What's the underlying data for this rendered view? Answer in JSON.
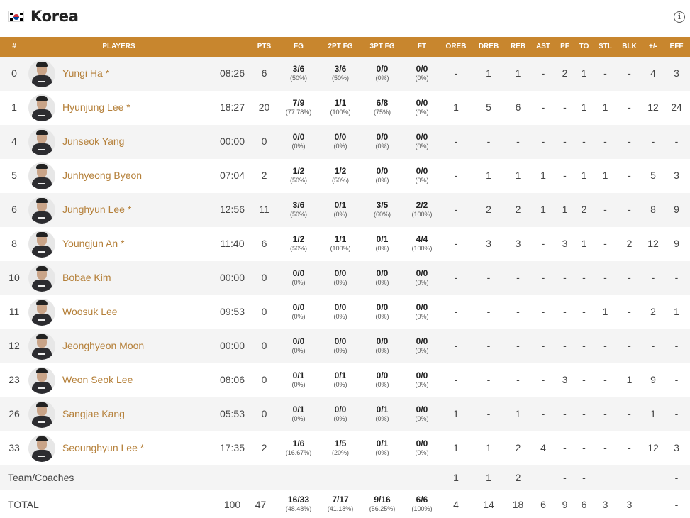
{
  "team": {
    "name": "Korea",
    "flag_icon": "korea-flag-icon",
    "info_icon": "info-icon"
  },
  "columns": [
    "#",
    "PLAYERS",
    "PTS",
    "FG",
    "2PT FG",
    "3PT FG",
    "FT",
    "OREB",
    "DREB",
    "REB",
    "AST",
    "PF",
    "TO",
    "STL",
    "BLK",
    "+/-",
    "EFF"
  ],
  "players": [
    {
      "no": "0",
      "name": "Yungi Ha *",
      "min": "08:26",
      "pts": "6",
      "fg": "3/6",
      "fgp": "(50%)",
      "fg2": "3/6",
      "fg2p": "(50%)",
      "fg3": "0/0",
      "fg3p": "(0%)",
      "ft": "0/0",
      "ftp": "(0%)",
      "oreb": "-",
      "dreb": "1",
      "reb": "1",
      "ast": "-",
      "pf": "2",
      "to": "1",
      "stl": "-",
      "blk": "-",
      "pm": "4",
      "eff": "3"
    },
    {
      "no": "1",
      "name": "Hyunjung Lee *",
      "min": "18:27",
      "pts": "20",
      "fg": "7/9",
      "fgp": "(77.78%)",
      "fg2": "1/1",
      "fg2p": "(100%)",
      "fg3": "6/8",
      "fg3p": "(75%)",
      "ft": "0/0",
      "ftp": "(0%)",
      "oreb": "1",
      "dreb": "5",
      "reb": "6",
      "ast": "-",
      "pf": "-",
      "to": "1",
      "stl": "1",
      "blk": "-",
      "pm": "12",
      "eff": "24"
    },
    {
      "no": "4",
      "name": "Junseok Yang",
      "min": "00:00",
      "pts": "0",
      "fg": "0/0",
      "fgp": "(0%)",
      "fg2": "0/0",
      "fg2p": "(0%)",
      "fg3": "0/0",
      "fg3p": "(0%)",
      "ft": "0/0",
      "ftp": "(0%)",
      "oreb": "-",
      "dreb": "-",
      "reb": "-",
      "ast": "-",
      "pf": "-",
      "to": "-",
      "stl": "-",
      "blk": "-",
      "pm": "-",
      "eff": "-"
    },
    {
      "no": "5",
      "name": "Junhyeong Byeon",
      "min": "07:04",
      "pts": "2",
      "fg": "1/2",
      "fgp": "(50%)",
      "fg2": "1/2",
      "fg2p": "(50%)",
      "fg3": "0/0",
      "fg3p": "(0%)",
      "ft": "0/0",
      "ftp": "(0%)",
      "oreb": "-",
      "dreb": "1",
      "reb": "1",
      "ast": "1",
      "pf": "-",
      "to": "1",
      "stl": "1",
      "blk": "-",
      "pm": "5",
      "eff": "3"
    },
    {
      "no": "6",
      "name": "Junghyun Lee *",
      "min": "12:56",
      "pts": "11",
      "fg": "3/6",
      "fgp": "(50%)",
      "fg2": "0/1",
      "fg2p": "(0%)",
      "fg3": "3/5",
      "fg3p": "(60%)",
      "ft": "2/2",
      "ftp": "(100%)",
      "oreb": "-",
      "dreb": "2",
      "reb": "2",
      "ast": "1",
      "pf": "1",
      "to": "2",
      "stl": "-",
      "blk": "-",
      "pm": "8",
      "eff": "9"
    },
    {
      "no": "8",
      "name": "Youngjun An *",
      "min": "11:40",
      "pts": "6",
      "fg": "1/2",
      "fgp": "(50%)",
      "fg2": "1/1",
      "fg2p": "(100%)",
      "fg3": "0/1",
      "fg3p": "(0%)",
      "ft": "4/4",
      "ftp": "(100%)",
      "oreb": "-",
      "dreb": "3",
      "reb": "3",
      "ast": "-",
      "pf": "3",
      "to": "1",
      "stl": "-",
      "blk": "2",
      "pm": "12",
      "eff": "9"
    },
    {
      "no": "10",
      "name": "Bobae Kim",
      "min": "00:00",
      "pts": "0",
      "fg": "0/0",
      "fgp": "(0%)",
      "fg2": "0/0",
      "fg2p": "(0%)",
      "fg3": "0/0",
      "fg3p": "(0%)",
      "ft": "0/0",
      "ftp": "(0%)",
      "oreb": "-",
      "dreb": "-",
      "reb": "-",
      "ast": "-",
      "pf": "-",
      "to": "-",
      "stl": "-",
      "blk": "-",
      "pm": "-",
      "eff": "-"
    },
    {
      "no": "11",
      "name": "Woosuk Lee",
      "min": "09:53",
      "pts": "0",
      "fg": "0/0",
      "fgp": "(0%)",
      "fg2": "0/0",
      "fg2p": "(0%)",
      "fg3": "0/0",
      "fg3p": "(0%)",
      "ft": "0/0",
      "ftp": "(0%)",
      "oreb": "-",
      "dreb": "-",
      "reb": "-",
      "ast": "-",
      "pf": "-",
      "to": "-",
      "stl": "1",
      "blk": "-",
      "pm": "2",
      "eff": "1"
    },
    {
      "no": "12",
      "name": "Jeonghyeon Moon",
      "min": "00:00",
      "pts": "0",
      "fg": "0/0",
      "fgp": "(0%)",
      "fg2": "0/0",
      "fg2p": "(0%)",
      "fg3": "0/0",
      "fg3p": "(0%)",
      "ft": "0/0",
      "ftp": "(0%)",
      "oreb": "-",
      "dreb": "-",
      "reb": "-",
      "ast": "-",
      "pf": "-",
      "to": "-",
      "stl": "-",
      "blk": "-",
      "pm": "-",
      "eff": "-"
    },
    {
      "no": "23",
      "name": "Weon Seok Lee",
      "min": "08:06",
      "pts": "0",
      "fg": "0/1",
      "fgp": "(0%)",
      "fg2": "0/1",
      "fg2p": "(0%)",
      "fg3": "0/0",
      "fg3p": "(0%)",
      "ft": "0/0",
      "ftp": "(0%)",
      "oreb": "-",
      "dreb": "-",
      "reb": "-",
      "ast": "-",
      "pf": "3",
      "to": "-",
      "stl": "-",
      "blk": "1",
      "pm": "9",
      "eff": "-"
    },
    {
      "no": "26",
      "name": "Sangjae Kang",
      "min": "05:53",
      "pts": "0",
      "fg": "0/1",
      "fgp": "(0%)",
      "fg2": "0/0",
      "fg2p": "(0%)",
      "fg3": "0/1",
      "fg3p": "(0%)",
      "ft": "0/0",
      "ftp": "(0%)",
      "oreb": "1",
      "dreb": "-",
      "reb": "1",
      "ast": "-",
      "pf": "-",
      "to": "-",
      "stl": "-",
      "blk": "-",
      "pm": "1",
      "eff": "-"
    },
    {
      "no": "33",
      "name": "Seounghyun Lee *",
      "min": "17:35",
      "pts": "2",
      "fg": "1/6",
      "fgp": "(16.67%)",
      "fg2": "1/5",
      "fg2p": "(20%)",
      "fg3": "0/1",
      "fg3p": "(0%)",
      "ft": "0/0",
      "ftp": "(0%)",
      "oreb": "1",
      "dreb": "1",
      "reb": "2",
      "ast": "4",
      "pf": "-",
      "to": "-",
      "stl": "-",
      "blk": "-",
      "pm": "12",
      "eff": "3"
    }
  ],
  "team_coaches": {
    "label": "Team/Coaches",
    "oreb": "1",
    "dreb": "1",
    "reb": "2",
    "pf": "-",
    "to": "-",
    "eff": "-"
  },
  "total": {
    "label": "TOTAL",
    "min": "100",
    "pts": "47",
    "fg": "16/33",
    "fgp": "(48.48%)",
    "fg2": "7/17",
    "fg2p": "(41.18%)",
    "fg3": "9/16",
    "fg3p": "(56.25%)",
    "ft": "6/6",
    "ftp": "(100%)",
    "oreb": "4",
    "dreb": "14",
    "reb": "18",
    "ast": "6",
    "pf": "9",
    "to": "6",
    "stl": "3",
    "blk": "3",
    "eff": "-"
  }
}
